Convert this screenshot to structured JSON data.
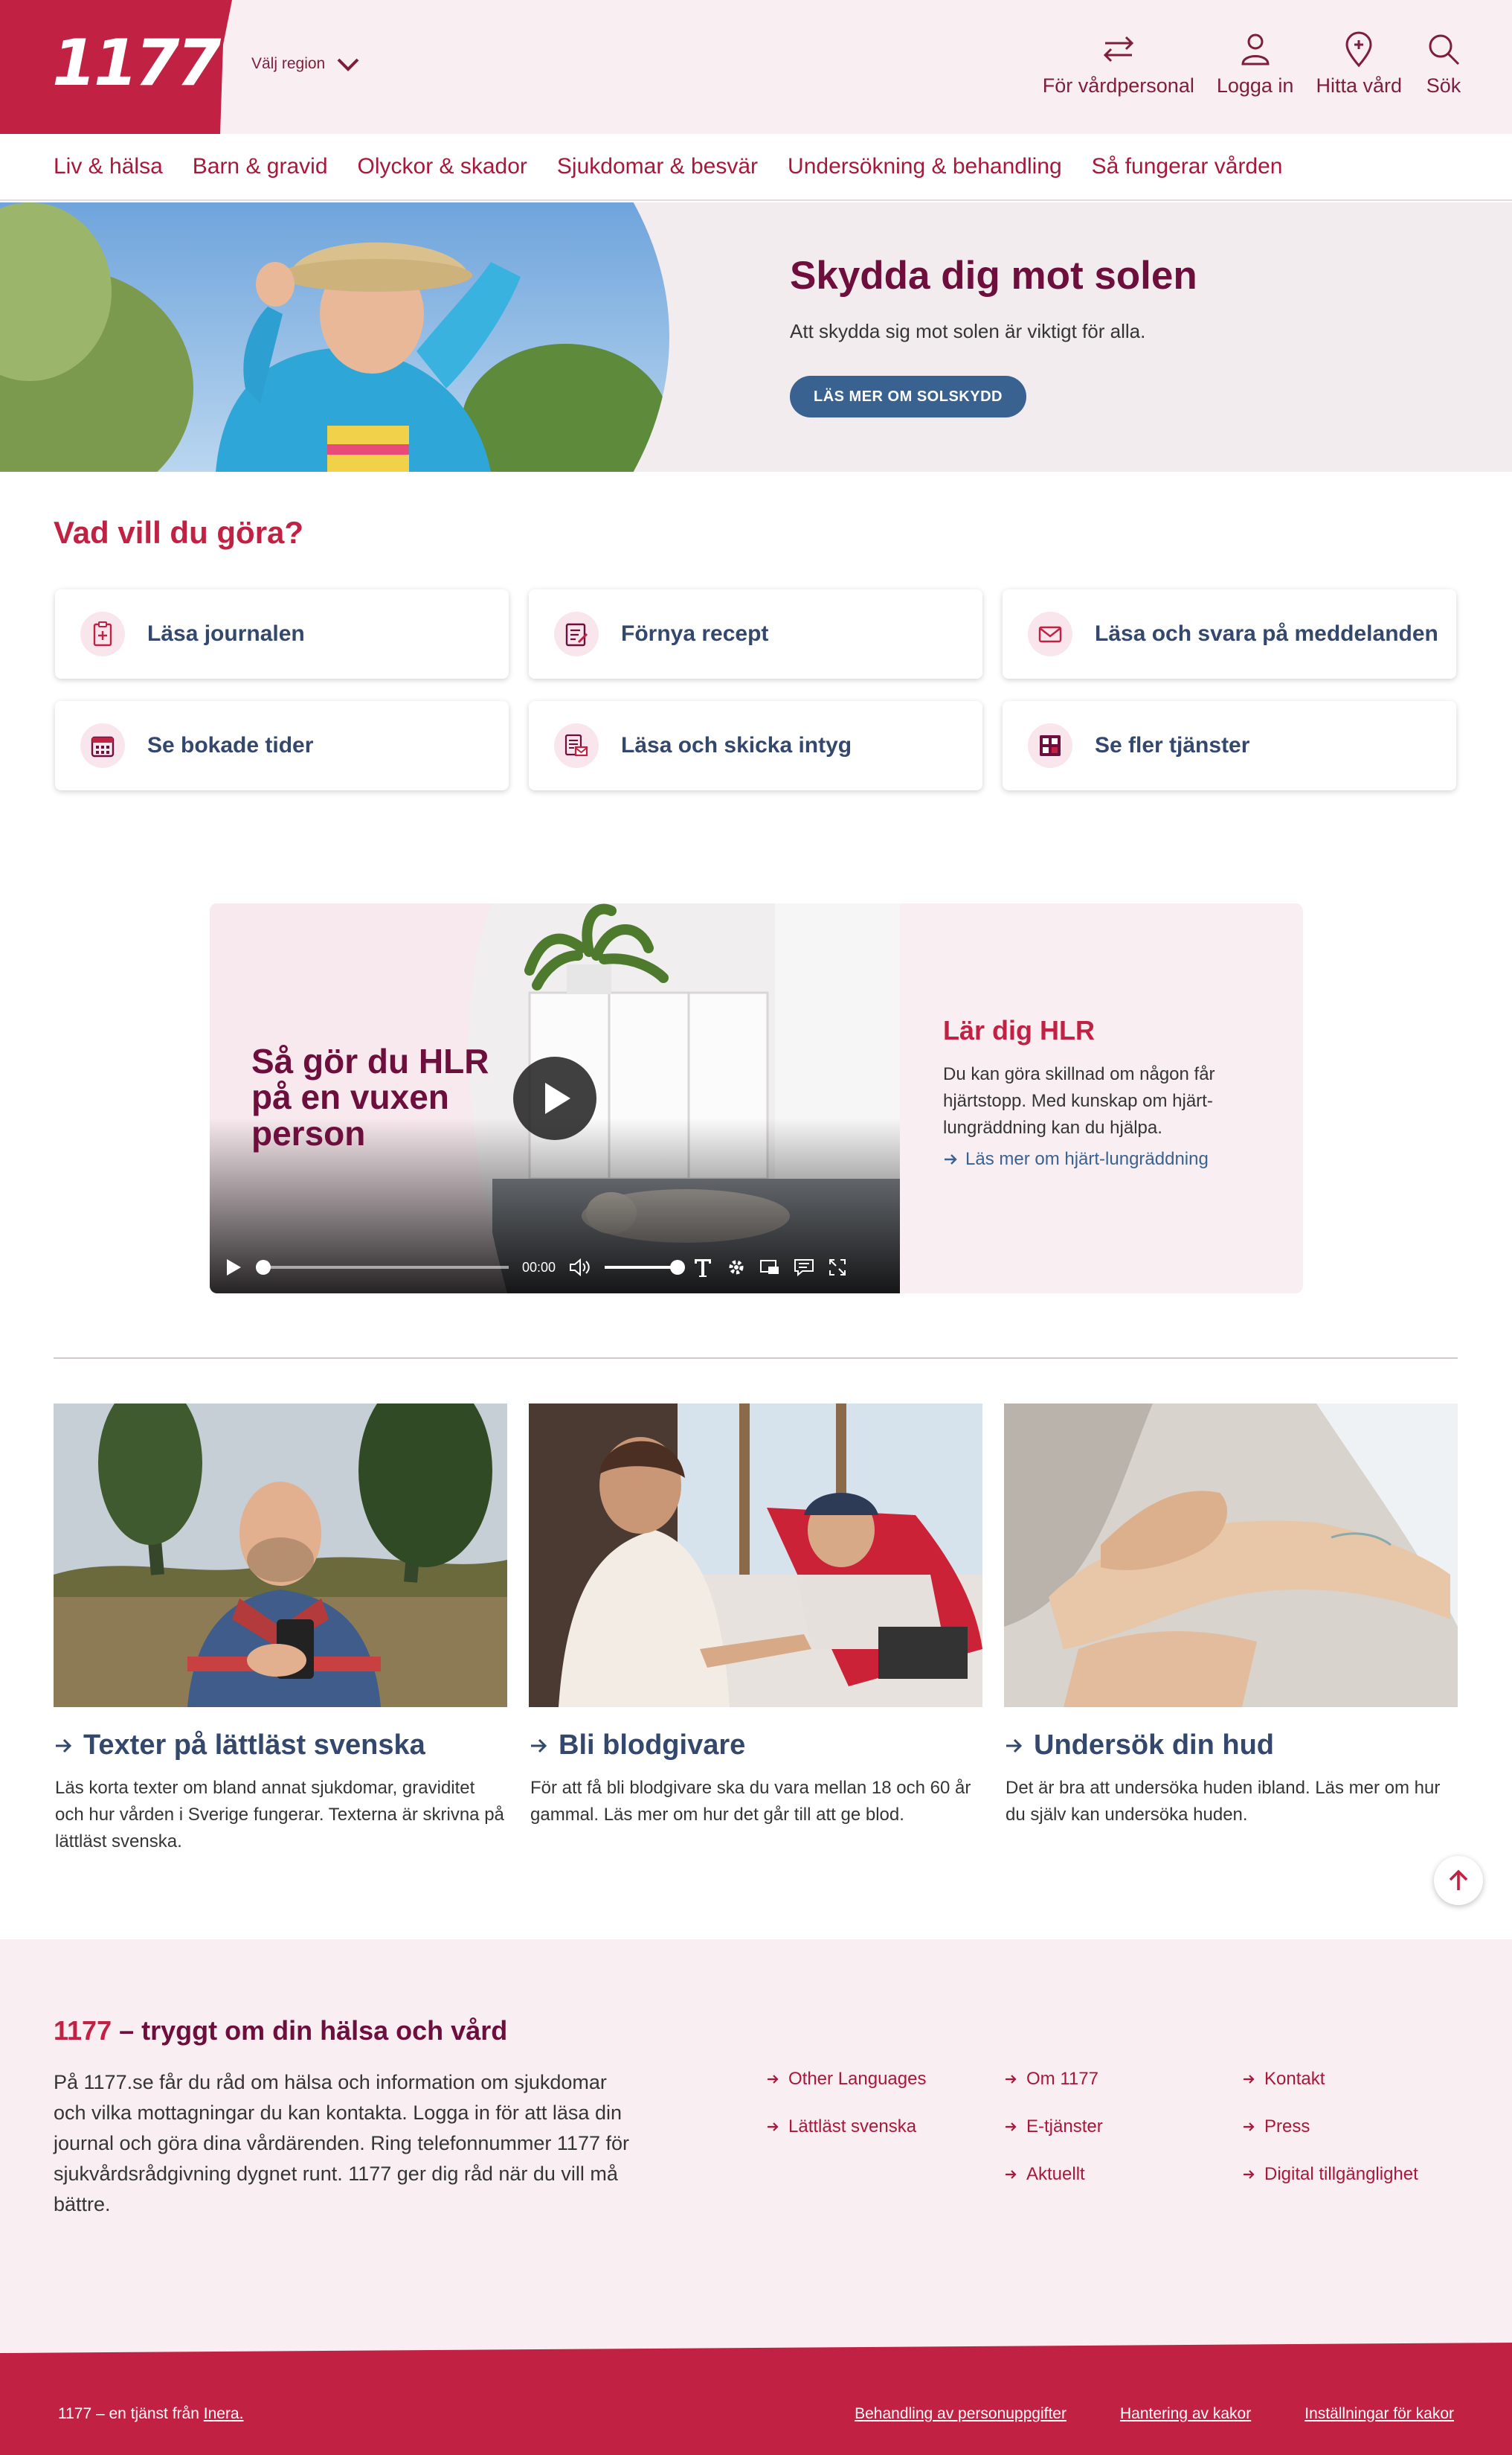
{
  "header": {
    "logo": "1177",
    "region_label": "Välj region",
    "actions": [
      {
        "label": "För vårdpersonal",
        "icon": "swap-arrows-icon"
      },
      {
        "label": "Logga in",
        "icon": "user-icon"
      },
      {
        "label": "Hitta vård",
        "icon": "location-pin-icon"
      },
      {
        "label": "Sök",
        "icon": "search-icon"
      }
    ]
  },
  "nav": {
    "items": [
      "Liv & hälsa",
      "Barn & gravid",
      "Olyckor & skador",
      "Sjukdomar & besvär",
      "Undersökning & behandling",
      "Så fungerar vården"
    ]
  },
  "hero": {
    "title": "Skydda dig mot solen",
    "text": "Att skydda sig mot solen är viktigt för alla.",
    "button": "LÄS MER OM SOLSKYDD"
  },
  "services": {
    "title": "Vad vill du göra?",
    "items": [
      {
        "label": "Läsa journalen",
        "icon": "journal-icon"
      },
      {
        "label": "Förnya recept",
        "icon": "prescription-icon"
      },
      {
        "label": "Läsa och svara på meddelanden",
        "icon": "envelope-icon"
      },
      {
        "label": "Se bokade tider",
        "icon": "calendar-icon"
      },
      {
        "label": "Läsa och skicka intyg",
        "icon": "certificate-icon"
      },
      {
        "label": "Se fler tjänster",
        "icon": "grid-icon"
      }
    ]
  },
  "video": {
    "title": "Så gör du HLR\npå en vuxen\nperson",
    "time": "00:00",
    "aside_title": "Lär dig HLR",
    "aside_text": "Du kan göra skillnad om någon får hjärtstopp. Med kunskap om hjärt-lungräddning kan du hjälpa.",
    "aside_link": "Läs mer om hjärt-lungräddning"
  },
  "articles": [
    {
      "title": "Texter på lättläst svenska",
      "text": "Läs korta texter om bland annat sjukdomar, graviditet och hur vården i Sverige fungerar. Texterna är skrivna på lättläst svenska."
    },
    {
      "title": "Bli blodgivare",
      "text": "För att få bli blodgivare ska du vara mellan 18 och 60 år gammal. Läs mer om hur det går till att ge blod."
    },
    {
      "title": "Undersök din hud",
      "text": "Det är bra att undersöka huden ibland. Läs mer om hur du själv kan undersöka huden."
    }
  ],
  "footer": {
    "title_brand": "1177",
    "title_rest": " – tryggt om din hälsa och vård",
    "text": "På 1177.se får du råd om hälsa och information om sjukdomar och vilka mottagningar du kan kontakta. Logga in för att läsa din journal och göra dina vårdärenden. Ring telefonnummer 1177 för sjukvårdsrådgivning dygnet runt. 1177 ger dig råd när du vill må bättre.",
    "links": [
      "Other Languages",
      "Om 1177",
      "Kontakt",
      "Lättläst svenska",
      "E-tjänster",
      "Press",
      "",
      "Aktuellt",
      "Digital tillgänglighet"
    ],
    "bottom_left_prefix": "1177 – en tjänst från ",
    "bottom_left_link": "Inera.",
    "bottom_links": [
      "Behandling av personuppgifter",
      "Hantering av kakor",
      "Inställningar för kakor"
    ]
  },
  "colors": {
    "brand_red": "#c12143",
    "dark_plum": "#6d0e3d",
    "link_blue": "#34486e",
    "button_blue": "#396291",
    "light_pink": "#f9eef1"
  }
}
